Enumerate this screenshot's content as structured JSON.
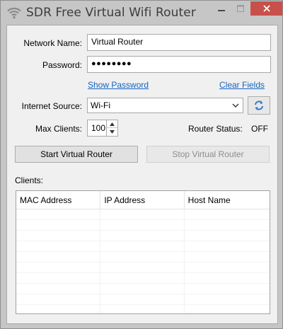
{
  "window": {
    "title": "SDR Free Virtual Wifi Router"
  },
  "form": {
    "network_name_label": "Network Name:",
    "network_name_value": "Virtual Router",
    "password_label": "Password:",
    "password_value": "●●●●●●●●",
    "show_password_link": "Show Password",
    "clear_fields_link": "Clear Fields",
    "internet_source_label": "Internet Source:",
    "internet_source_value": "Wi-Fi",
    "max_clients_label": "Max Clients:",
    "max_clients_value": "100",
    "router_status_label": "Router Status:",
    "router_status_value": "OFF"
  },
  "buttons": {
    "start_label": "Start Virtual Router",
    "stop_label": "Stop Virtual Router"
  },
  "clients": {
    "label": "Clients:",
    "columns": [
      "MAC Address",
      "IP Address",
      "Host Name"
    ],
    "rows": []
  },
  "colors": {
    "link": "#1565c0",
    "close_button": "#c7504b",
    "refresh_icon": "#3a78c9"
  },
  "icons": {
    "app": "wifi-icon",
    "refresh": "refresh-icon"
  }
}
